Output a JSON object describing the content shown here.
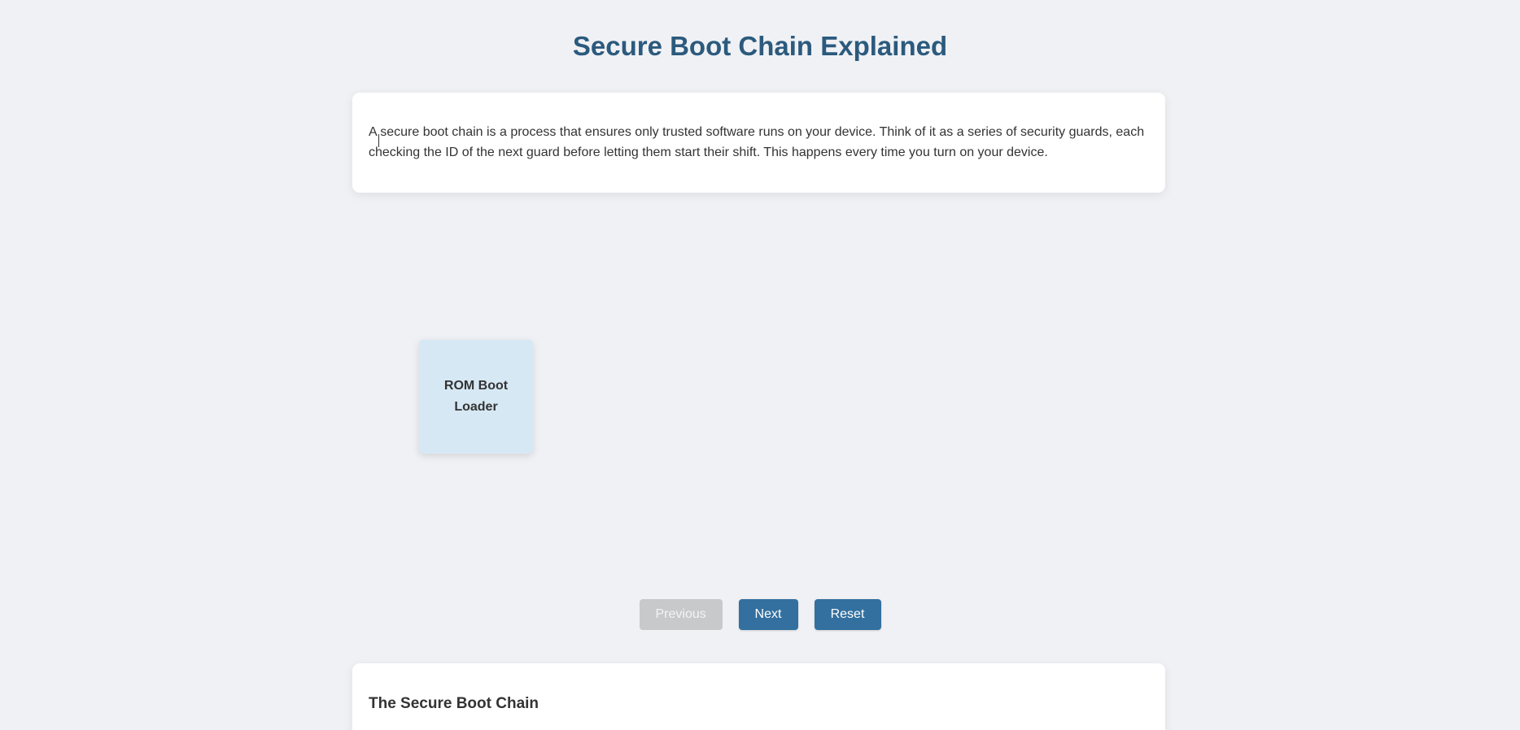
{
  "page": {
    "title": "Secure Boot Chain Explained"
  },
  "intro": {
    "text": "A secure boot chain is a process that ensures only trusted software runs on your device. Think of it as a series of security guards, each checking the ID of the next guard before letting them start their shift. This happens every time you turn on your device."
  },
  "diagram": {
    "nodes": [
      {
        "label": "ROM Boot Loader",
        "color": "#d7e8f5"
      }
    ]
  },
  "controls": {
    "previous_label": "Previous",
    "previous_disabled": true,
    "next_label": "Next",
    "reset_label": "Reset"
  },
  "chain_section": {
    "heading": "The Secure Boot Chain"
  },
  "colors": {
    "title": "#2b5a7d",
    "button": "#33709f",
    "button_disabled": "#c8c9cb",
    "background": "#f0f1f5"
  }
}
